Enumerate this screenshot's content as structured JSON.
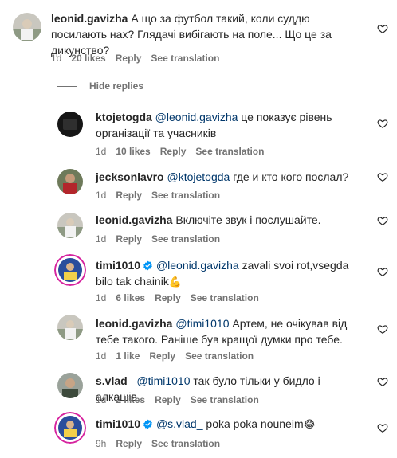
{
  "icons": {
    "like": "heart-outline-icon",
    "verified": "verified-badge-icon"
  },
  "colors": {
    "mention": "#00376b",
    "meta": "#737373",
    "verified": "#0095f6"
  },
  "hide_replies": "Hide replies",
  "comments": [
    {
      "user": "leonid.gavizha",
      "text": "А що за футбол такий, коли суддю посилають нах? Глядачі вибігають на поле... Що це за дикунство?",
      "time": "1d",
      "likes": "20 likes",
      "reply": "Reply",
      "translate": "See translation"
    },
    {
      "user": "ktojetogda",
      "mention": "@leonid.gavizha",
      "text": "це показує рівень організації та учасників",
      "time": "1d",
      "likes": "10 likes",
      "reply": "Reply",
      "translate": "See translation"
    },
    {
      "user": "jecksonlavro",
      "mention": "@ktojetogda",
      "text": "где и кто кого послал?",
      "time": "1d",
      "reply": "Reply",
      "translate": "See translation"
    },
    {
      "user": "leonid.gavizha",
      "text": "Включіте звук і послушайте.",
      "time": "1d",
      "reply": "Reply",
      "translate": "See translation"
    },
    {
      "user": "timi1010",
      "mention": "@leonid.gavizha",
      "text": "zavali svoi rot,vsegda bilo tak chainik",
      "emoji": "💪",
      "time": "1d",
      "likes": "6 likes",
      "reply": "Reply",
      "translate": "See translation"
    },
    {
      "user": "leonid.gavizha",
      "mention": "@timi1010",
      "text": "Артем, не очікував від тебе такого. Раніше був кращої думки про тебе.",
      "time": "1d",
      "likes": "1 like",
      "reply": "Reply",
      "translate": "See translation"
    },
    {
      "user": "s.vlad_",
      "mention": "@timi1010",
      "text": "так було тільки у бидло і алкашів",
      "time": "1d",
      "likes": "2 likes",
      "reply": "Reply",
      "translate": "See translation"
    },
    {
      "user": "timi1010",
      "mention": "@s.vlad_",
      "text": "poka poka nouneim",
      "emoji": "😂",
      "time": "9h",
      "reply": "Reply",
      "translate": "See translation"
    }
  ]
}
